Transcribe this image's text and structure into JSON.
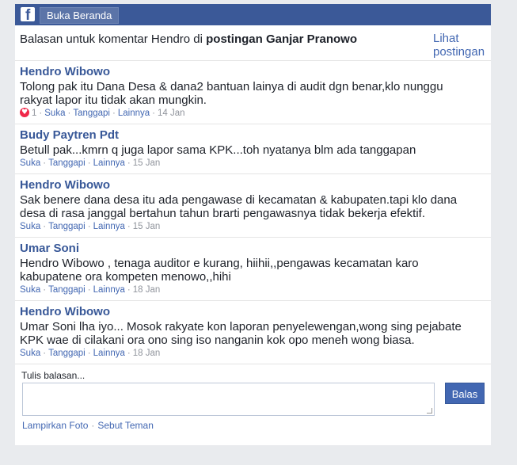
{
  "topbar": {
    "logo_letter": "f",
    "home_label": "Buka Beranda"
  },
  "header": {
    "title_prefix": "Balasan untuk komentar Hendro di ",
    "title_post": "postingan Ganjar Pranowo",
    "view_post_label": "Lihat postingan"
  },
  "actions": {
    "like": "Suka",
    "reply": "Tanggapi",
    "more": "Lainnya"
  },
  "comments": [
    {
      "name": "Hendro Wibowo",
      "text": "Tolong pak itu Dana Desa & dana2 bantuan lainya di audit dgn benar,klo nunggu rakyat lapor itu tidak akan mungkin.",
      "reaction_count": "1",
      "date": "14 Jan"
    },
    {
      "name": "Budy Paytren Pdt",
      "text": "Betull pak...kmrn q juga lapor sama KPK...toh nyatanya blm ada tanggapan",
      "date": "15 Jan"
    },
    {
      "name": "Hendro Wibowo",
      "text": "Sak benere dana desa itu ada pengawase di kecamatan & kabupaten.tapi klo dana desa di rasa janggal bertahun tahun brarti pengawasnya tidak bekerja efektif.",
      "date": "15 Jan"
    },
    {
      "name": "Umar Soni",
      "text": "Hendro Wibowo , tenaga auditor e kurang, hiihii,,pengawas kecamatan karo kabupatene ora kompeten menowo,,hihi",
      "date": "18 Jan"
    },
    {
      "name": "Hendro Wibowo",
      "text": "Umar Soni lha iyo... Mosok rakyate kon laporan penyelewengan,wong sing pejabate KPK wae di cilakani ora ono sing iso nanganin kok opo meneh wong biasa.",
      "date": "18 Jan"
    }
  ],
  "reply": {
    "label": "Tulis balasan...",
    "send_label": "Balas",
    "attach_photo": "Lampirkan Foto",
    "mention": "Sebut Teman"
  },
  "colors": {
    "brand": "#3b5998",
    "link": "#4267b2",
    "name": "#385898",
    "meta": "#90949c",
    "heart": "#f0284a"
  }
}
